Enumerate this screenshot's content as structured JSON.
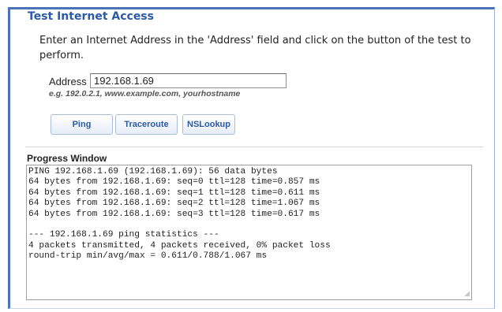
{
  "title": "Test Internet Access",
  "intro": "Enter an Internet Address in the 'Address' field and click on the button of the test to perform.",
  "address": {
    "label": "Address",
    "value": "192.168.1.69",
    "hint": "e.g. 192.0.2.1, www.example.com, yourhostname"
  },
  "buttons": {
    "ping": "Ping",
    "traceroute": "Traceroute",
    "nslookup": "NSLookup"
  },
  "progress": {
    "label": "Progress Window",
    "lines": [
      "PING 192.168.1.69 (192.168.1.69): 56 data bytes",
      "64 bytes from 192.168.1.69: seq=0 ttl=128 time=0.857 ms",
      "64 bytes from 192.168.1.69: seq=1 ttl=128 time=0.611 ms",
      "64 bytes from 192.168.1.69: seq=2 ttl=128 time=1.067 ms",
      "64 bytes from 192.168.1.69: seq=3 ttl=128 time=0.617 ms",
      "",
      "--- 192.168.1.69 ping statistics ---",
      "4 packets transmitted, 4 packets received, 0% packet loss",
      "round-trip min/avg/max = 0.611/0.788/1.067 ms"
    ]
  },
  "colors": {
    "accent": "#2a5aa8",
    "frame_border": "#4a73b8"
  }
}
